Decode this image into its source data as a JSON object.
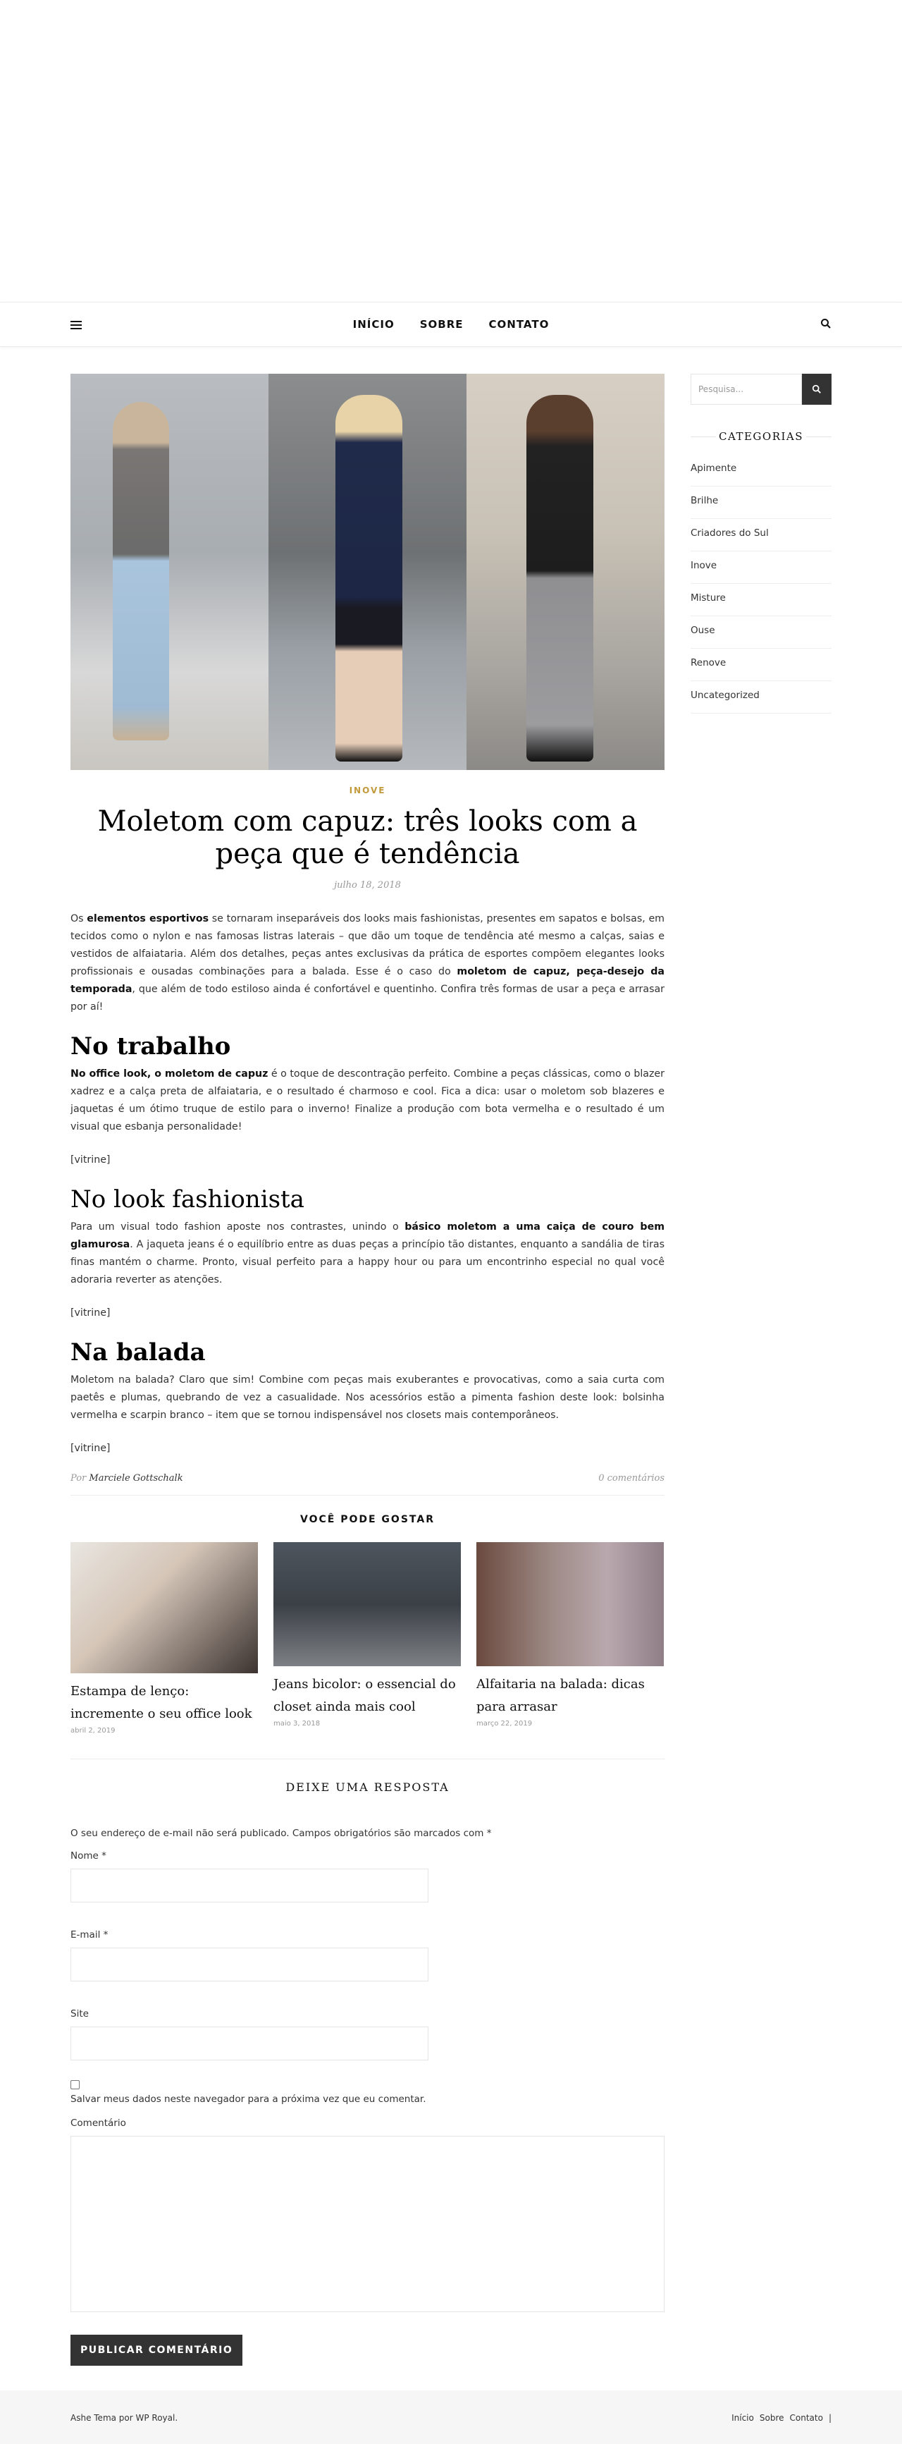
{
  "nav": {
    "items": [
      "INÍCIO",
      "SOBRE",
      "CONTATO"
    ]
  },
  "post": {
    "category": "INOVE",
    "title": "Moletom com capuz: três looks com a peça que é tendência",
    "date": "julho 18, 2018",
    "intro": {
      "t1": "Os ",
      "b1": "elementos esportivos",
      "t2": " se tornaram inseparáveis dos looks mais fashionistas, presentes em sapatos e bolsas, em tecidos como o nylon e nas famosas listras laterais – que dão um toque de tendência até mesmo a calças, saias e vestidos de alfaiataria. Além dos detalhes, peças antes exclusivas da prática de esportes  compõem elegantes looks profissionais e ousadas combinações para a balada. Esse é o caso do ",
      "b2": "moletom de capuz, peça-desejo da temporada",
      "t3": ", que além de todo estiloso ainda é confortável e quentinho. Confira três formas de usar a peça e arrasar por aí!"
    },
    "s1": {
      "heading": "No trabalho",
      "b1": "No office look, o moletom de capuz",
      "t1": " é o toque de descontração perfeito. Combine a peças clássicas, como o blazer xadrez e a calça preta de alfaiataria, e o resultado é charmoso e cool. Fica a dica: usar o moletom sob blazeres e jaquetas é um ótimo truque de estilo para o inverno! Finalize a produção com bota vermelha e o resultado é um visual que esbanja personalidade!",
      "vitrine": "[vitrine]"
    },
    "s2": {
      "heading": "No look fashionista",
      "t1": "Para um visual todo fashion aposte nos contrastes, unindo o ",
      "b1": "básico moletom a uma caiça de couro bem glamurosa",
      "t2": ". A jaqueta jeans é o equilíbrio entre as duas peças a princípio tão distantes, enquanto a sandália de tiras finas mantém o charme. Pronto, visual perfeito para a happy hour ou para um encontrinho especial no qual você adoraria reverter as atenções.",
      "vitrine": "[vitrine]"
    },
    "s3": {
      "heading": "Na balada",
      "t1": "Moletom na balada? Claro que sim! Combine com peças mais exuberantes e provocativas, como a saia curta com paetês e plumas, quebrando de vez a casualidade. Nos acessórios estão a pimenta fashion deste look: bolsinha vermelha e scarpin branco – item que se tornou indispensável nos closets mais contemporâneos.",
      "vitrine": "[vitrine]"
    },
    "by": "Por",
    "author": "Marciele Gottschalk",
    "comments": "0 comentários"
  },
  "related": {
    "title": "VOCÊ PODE GOSTAR",
    "items": [
      {
        "title": "Estampa de lenço: incremente o seu office look",
        "date": "abril 2, 2019"
      },
      {
        "title": "Jeans bicolor: o essencial do closet ainda mais cool",
        "date": "maio 3, 2018"
      },
      {
        "title": "Alfaitaria na balada: dicas para arrasar",
        "date": "março 22, 2019"
      }
    ]
  },
  "reply": {
    "title": "DEIXE UMA RESPOSTA",
    "note": "O seu endereço de e-mail não será publicado. Campos obrigatórios são marcados com *",
    "name_label": "Nome *",
    "email_label": "E-mail *",
    "site_label": "Site",
    "save_label": "Salvar meus dados neste navegador para a próxima vez que eu comentar.",
    "comment_label": "Comentário",
    "submit": "PUBLICAR COMENTÁRIO"
  },
  "sidebar": {
    "search_placeholder": "Pesquisa...",
    "categories_title": "CATEGORIAS",
    "categories": [
      "Apimente",
      "Brilhe",
      "Criadores do Sul",
      "Inove",
      "Misture",
      "Ouse",
      "Renove",
      "Uncategorized"
    ]
  },
  "footer": {
    "credit": "Ashe Tema por WP Royal.",
    "links": [
      "Início",
      "Sobre",
      "Contato",
      "|"
    ]
  },
  "colors": {
    "accent": "#c29a3b",
    "dark": "#333333"
  }
}
